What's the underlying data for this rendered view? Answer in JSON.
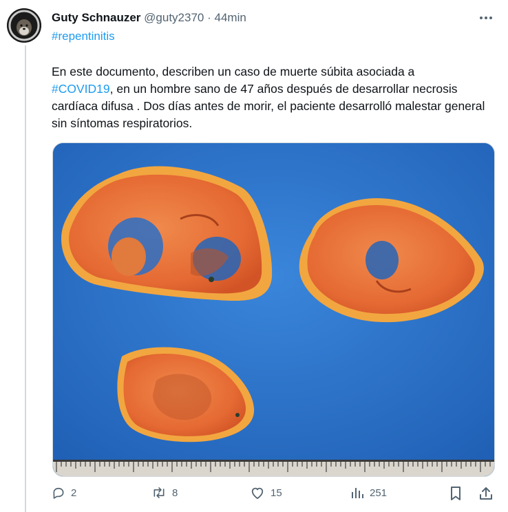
{
  "tweet": {
    "author_name": "Guty Schnauzer",
    "handle": "@guty2370",
    "separator": "·",
    "time": "44min",
    "hashtag": "#repentinitis",
    "text_before": "En este documento, describen un caso de muerte súbita asociada a",
    "text_link": "#COVID19",
    "text_after": ", en un hombre sano de 47 años después de desarrollar necrosis cardíaca difusa . Dos días antes de morir, el paciente desarrolló malestar general sin síntomas respiratorios."
  },
  "actions": {
    "replies": "2",
    "retweets": "8",
    "likes": "15",
    "views": "251"
  },
  "icons": {
    "more": "more-dots-icon",
    "reply": "reply-icon",
    "retweet": "retweet-icon",
    "like": "heart-icon",
    "views": "analytics-icon",
    "bookmark": "bookmark-icon",
    "share": "share-icon"
  },
  "colors": {
    "link": "#1d9bf0",
    "text": "#0f1419",
    "muted": "#536471",
    "media_background": "#2a6fc7"
  }
}
